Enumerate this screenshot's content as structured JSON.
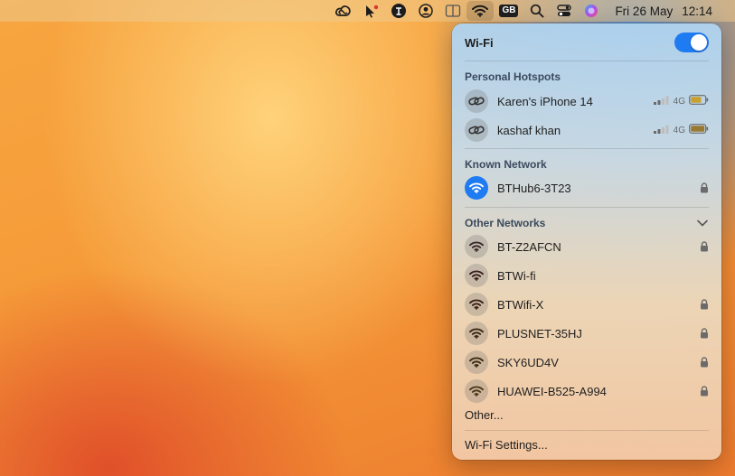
{
  "menubar": {
    "clock": {
      "date": "Fri 26 May",
      "time": "12:14"
    },
    "keyboard_badge": "GB"
  },
  "panel": {
    "title": "Wi-Fi",
    "wifi_enabled": true,
    "sections": {
      "personal_hotspots": "Personal Hotspots",
      "known_network": "Known Network",
      "other_networks": "Other Networks"
    },
    "hotspots": [
      {
        "name": "Karen's iPhone 14",
        "cell": "4G",
        "battery_level": 0.75,
        "battery_color": "#c9a030"
      },
      {
        "name": "kashaf khan",
        "cell": "4G",
        "battery_level": 1.0,
        "battery_color": "#9a7a30"
      }
    ],
    "known": [
      {
        "name": "BTHub6-3T23",
        "locked": true
      }
    ],
    "others": [
      {
        "name": "BT-Z2AFCN",
        "locked": true
      },
      {
        "name": "BTWi-fi",
        "locked": false
      },
      {
        "name": "BTWifi-X",
        "locked": true
      },
      {
        "name": "PLUSNET-35HJ",
        "locked": true
      },
      {
        "name": "SKY6UD4V",
        "locked": true
      },
      {
        "name": "HUAWEI-B525-A994",
        "locked": true
      }
    ],
    "other_link": "Other...",
    "settings_link": "Wi-Fi Settings..."
  },
  "colors": {
    "accent": "#1f7bf2"
  }
}
